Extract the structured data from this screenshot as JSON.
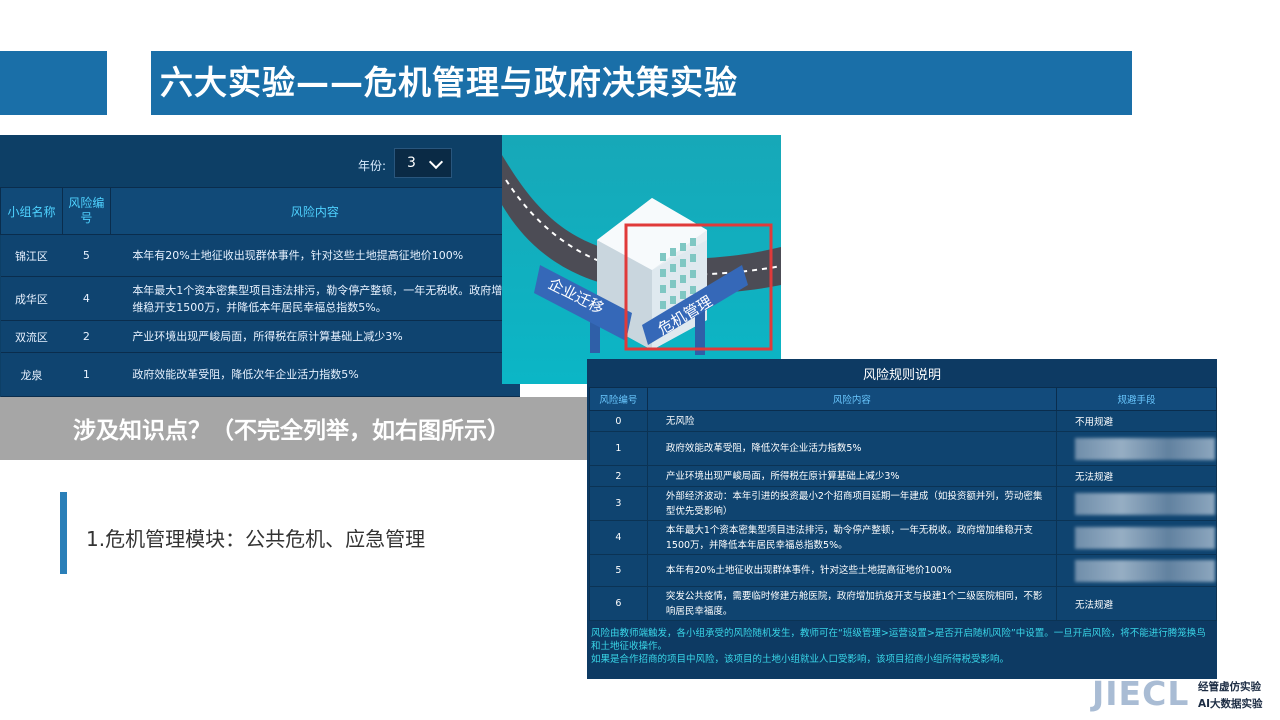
{
  "header": {
    "title": "六大实验——危机管理与政府决策实验"
  },
  "risk_table": {
    "year_label": "年份:",
    "year_value": "3",
    "columns": [
      "小组名称",
      "风险编号",
      "风险内容"
    ],
    "rows": [
      {
        "group": "锦江区",
        "id": "5",
        "content": "本年有20%土地征收出现群体事件，针对这些土地提高征地价100%"
      },
      {
        "group": "成华区",
        "id": "4",
        "content": "本年最大1个资本密集型项目违法排污，勒令停产整顿，一年无税收。政府增加维稳开支1500万，并降低本年居民幸福总指数5%。"
      },
      {
        "group": "双流区",
        "id": "2",
        "content": "产业环境出现严峻局面，所得税在原计算基础上减少3%"
      },
      {
        "group": "龙泉",
        "id": "1",
        "content": "政府效能改革受阻，降低次年企业活力指数5%"
      }
    ]
  },
  "illustration": {
    "sign_left": "企业迁移",
    "sign_right": "危机管理"
  },
  "knowledge": {
    "title": "涉及知识点？（不完全列举，如右图所示）"
  },
  "module": {
    "text": "1.危机管理模块：公共危机、应急管理"
  },
  "rules_panel": {
    "title": "风险规则说明",
    "columns": [
      "风险编号",
      "风险内容",
      "规避手段"
    ],
    "rows": [
      {
        "id": "0",
        "content": "无风险",
        "avoid": "不用规避"
      },
      {
        "id": "1",
        "content": "政府效能改革受阻，降低次年企业活力指数5%",
        "avoid": ""
      },
      {
        "id": "2",
        "content": "产业环境出现严峻局面，所得税在原计算基础上减少3%",
        "avoid": "无法规避"
      },
      {
        "id": "3",
        "content": "外部经济波动：本年引进的投资最小2个招商项目延期一年建成（如投资额并列，劳动密集型优先受影响）",
        "avoid": ""
      },
      {
        "id": "4",
        "content": "本年最大1个资本密集型项目违法排污，勒令停产整顿，一年无税收。政府增加维稳开支1500万，并降低本年居民幸福总指数5%。",
        "avoid": ""
      },
      {
        "id": "5",
        "content": "本年有20%土地征收出现群体事件，针对这些土地提高征地价100%",
        "avoid": ""
      },
      {
        "id": "6",
        "content": "突发公共疫情，需要临时修建方舱医院，政府增加抗疫开支与投建1个二级医院相同，不影响居民幸福度。",
        "avoid": "无法规避"
      }
    ],
    "note_1": "风险由教师端触发，各小组承受的风险随机发生，教师可在“班级管理>运营设置>是否开启随机风险”中设置。一旦开启风险，将不能进行腾笼换鸟和土地征收操作。",
    "note_2": "如果是合作招商的项目中风险，该项目的土地小组就业人口受影响，该项目招商小组所得税受影响。"
  },
  "logo": {
    "mark": "JIECL",
    "line1": "经管虚仿实验",
    "line2": "AI大数据实验"
  },
  "colors": {
    "header_blue": "#1a6fa8",
    "panel_navy": "#0d3f66",
    "accent_cyan": "#4fd2ff",
    "knowledge_gray": "#a6a6a6",
    "highlight_red": "#e03a3a"
  }
}
